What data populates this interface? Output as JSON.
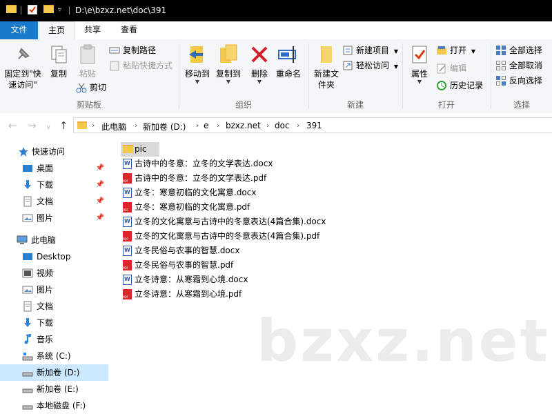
{
  "window": {
    "title_path": "D:\\e\\bzxz.net\\doc\\391"
  },
  "tabs": {
    "file": "文件",
    "home": "主页",
    "share": "共享",
    "view": "查看"
  },
  "ribbon": {
    "clipboard": {
      "pin_quick_access": "固定到\"快速访问\"",
      "copy": "复制",
      "paste": "粘贴",
      "copy_path": "复制路径",
      "paste_shortcut": "粘贴快捷方式",
      "cut": "剪切",
      "group_label": "剪贴板"
    },
    "organize": {
      "move_to": "移动到",
      "copy_to": "复制到",
      "delete": "删除",
      "rename": "重命名",
      "group_label": "组织"
    },
    "new": {
      "new_folder": "新建文件夹",
      "new_item": "新建项目",
      "easy_access": "轻松访问",
      "group_label": "新建"
    },
    "open": {
      "properties": "属性",
      "open": "打开",
      "edit": "编辑",
      "history": "历史记录",
      "group_label": "打开"
    },
    "select": {
      "select_all": "全部选择",
      "select_none": "全部取消",
      "invert": "反向选择",
      "group_label": "选择"
    }
  },
  "address": {
    "crumbs": [
      "此电脑",
      "新加卷 (D:)",
      "e",
      "bzxz.net",
      "doc",
      "391"
    ]
  },
  "nav": {
    "quick_access": "快速访问",
    "desktop_pinned": "桌面",
    "downloads_pinned": "下载",
    "documents_pinned": "文档",
    "pictures_pinned": "图片",
    "this_pc": "此电脑",
    "desktop": "Desktop",
    "videos": "视频",
    "pictures": "图片",
    "documents": "文档",
    "downloads": "下载",
    "music": "音乐",
    "drive_c": "系统 (C:)",
    "drive_d": "新加卷 (D:)",
    "drive_e": "新加卷 (E:)",
    "drive_f": "本地磁盘 (F:)"
  },
  "files": [
    {
      "name": "pic",
      "type": "folder"
    },
    {
      "name": "古诗中的冬意：立冬的文学表达.docx",
      "type": "docx"
    },
    {
      "name": "古诗中的冬意：立冬的文学表达.pdf",
      "type": "pdf"
    },
    {
      "name": "立冬：寒意初临的文化寓意.docx",
      "type": "docx"
    },
    {
      "name": "立冬：寒意初临的文化寓意.pdf",
      "type": "pdf"
    },
    {
      "name": "立冬的文化寓意与古诗中的冬意表达(4篇合集).docx",
      "type": "docx"
    },
    {
      "name": "立冬的文化寓意与古诗中的冬意表达(4篇合集).pdf",
      "type": "pdf"
    },
    {
      "name": "立冬民俗与农事的智慧.docx",
      "type": "docx"
    },
    {
      "name": "立冬民俗与农事的智慧.pdf",
      "type": "pdf"
    },
    {
      "name": "立冬诗意：从寒霜到心境.docx",
      "type": "docx"
    },
    {
      "name": "立冬诗意：从寒霜到心境.pdf",
      "type": "pdf"
    }
  ],
  "watermark": "bzxz.net",
  "colors": {
    "accent": "#1979ca",
    "selected_nav": "#cce8ff",
    "pdf_red": "#e0242c",
    "word_blue": "#2b5aa8",
    "folder": "#f3c84b"
  }
}
